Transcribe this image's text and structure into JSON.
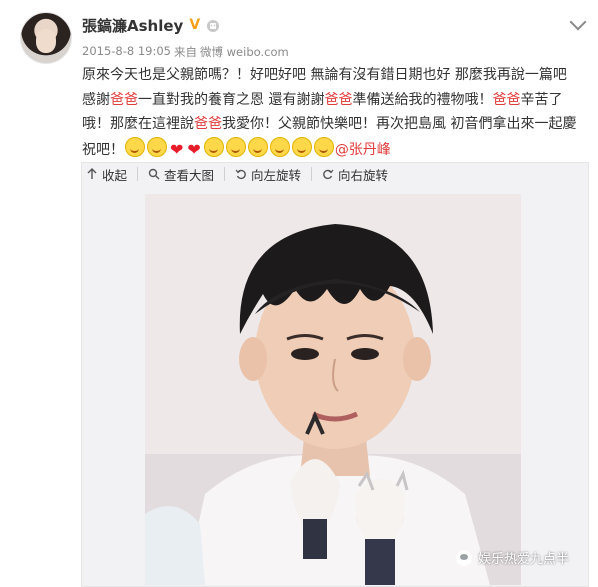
{
  "post": {
    "username": "張鎬濂Ashley",
    "verified_badge": "V",
    "meta": {
      "time": "2015-8-8 19:05",
      "source_prefix": "来自",
      "source": "微博 weibo.com"
    },
    "content": {
      "line1": "原來今天也是父親節嗎？！好吧好吧 無論有沒有錯日期也好 那麼我再說一篇吧",
      "l2_a": "感謝",
      "l2_red1": "爸爸",
      "l2_b": "一直對我的養育之恩 還有謝謝",
      "l2_red2": "爸爸",
      "l2_c": "準備送給我的禮物哦！",
      "l2_red3": "爸爸",
      "l2_d": "辛苦了",
      "l3_a": "哦！那麼在這裡說",
      "l3_red": "爸爸",
      "l3_b": "我愛你！父親節快樂吧！再次把島風 初音們拿出來一起慶",
      "l4_a": "祝吧！",
      "mention": "@张丹峰"
    },
    "toolbar": {
      "collapse": "收起",
      "view_large": "查看大图",
      "rotate_left": "向左旋转",
      "rotate_right": "向右旋转"
    },
    "watermark": "娱乐热爱九点半"
  },
  "colors": {
    "text": "#333333",
    "meta": "#8a8a8a",
    "highlight_red": "#e13b3b",
    "verified_gold": "#f7a11a"
  }
}
